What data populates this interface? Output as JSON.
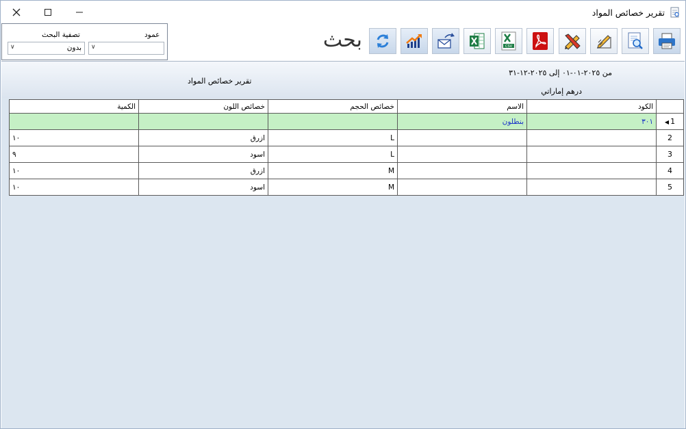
{
  "window": {
    "title": "تقرير خصائص المواد"
  },
  "search": {
    "label": "بحث"
  },
  "filters": {
    "column_label": "عمود",
    "column_value": "",
    "filter_label": "تصفية البحث",
    "filter_value": "بدون"
  },
  "report": {
    "date_range": "من ٢٠٢٥-٠١-٠١ إلى ٢٠٢٥-١٢-٣١",
    "currency": "درهم إماراتي",
    "title": "تقرير خصائص المواد"
  },
  "toolbar": {
    "icons": [
      "print-icon",
      "preview-icon",
      "edit-icon",
      "design-icon",
      "pdf-icon",
      "csv-icon",
      "excel-icon",
      "email-icon",
      "chart-icon",
      "refresh-icon"
    ]
  },
  "table": {
    "headers": {
      "code": "الكود",
      "name": "الاسم",
      "size": "خصائص الحجم",
      "color": "خصائص اللون",
      "qty": "الكمية"
    },
    "rows": [
      {
        "num": "1",
        "code": "٣٠١",
        "name": "بنطلون",
        "size": "",
        "color": "",
        "qty": ""
      },
      {
        "num": "2",
        "code": "",
        "name": "",
        "size": "L",
        "color": "ازرق",
        "qty": "١٠"
      },
      {
        "num": "3",
        "code": "",
        "name": "",
        "size": "L",
        "color": "اسود",
        "qty": "٩"
      },
      {
        "num": "4",
        "code": "",
        "name": "",
        "size": "M",
        "color": "ازرق",
        "qty": "١٠"
      },
      {
        "num": "5",
        "code": "",
        "name": "",
        "size": "M",
        "color": "اسود",
        "qty": "١٠"
      }
    ]
  },
  "colors": {
    "selected_row": "#c5f0c5",
    "grid_bg": "#dce6f0",
    "link_text": "#1a33c8"
  }
}
